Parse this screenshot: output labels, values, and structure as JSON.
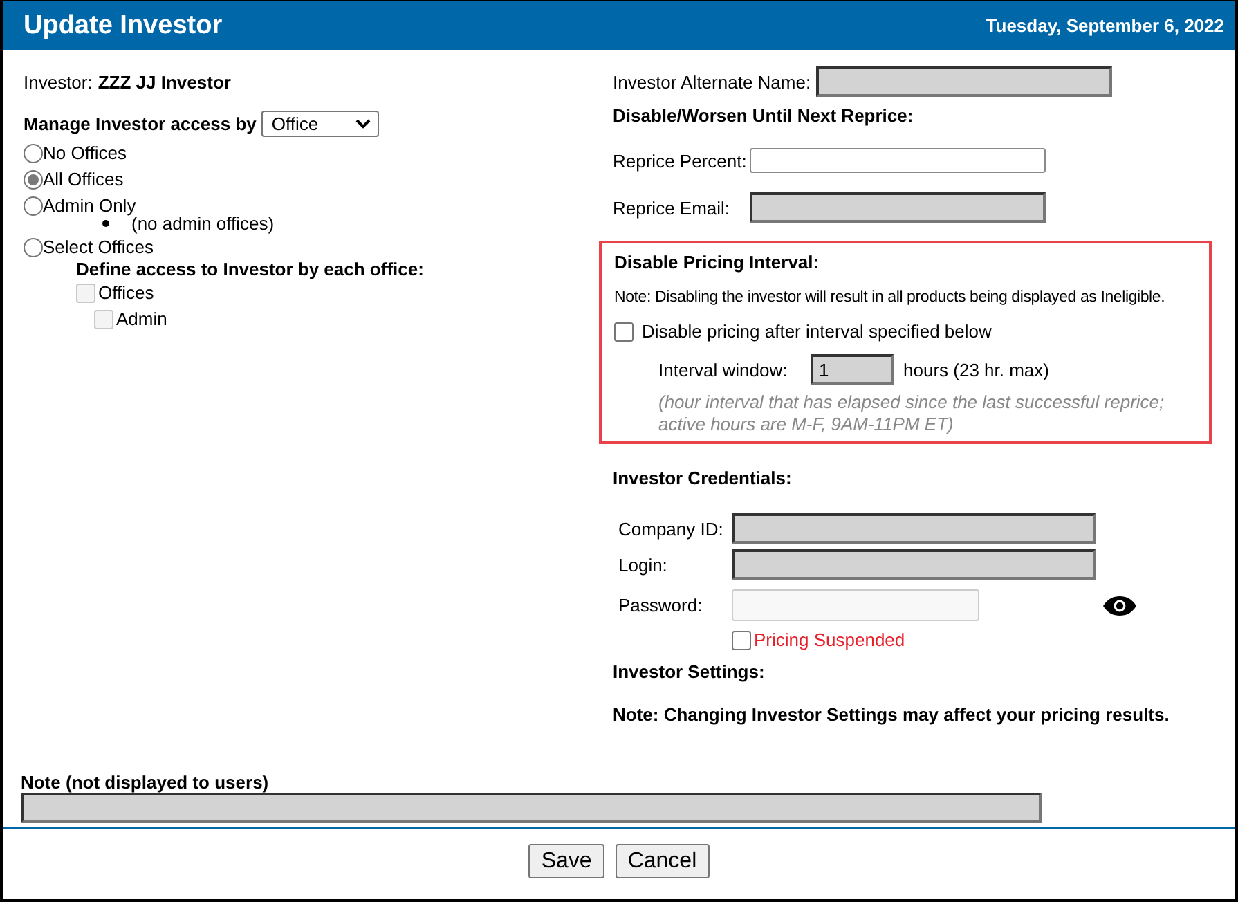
{
  "window": {
    "title": "Update Investor",
    "date": "Tuesday, September 6, 2022"
  },
  "investor": {
    "label": "Investor:",
    "name": "ZZZ JJ Investor"
  },
  "access": {
    "label": "Manage Investor access by",
    "select_value": "Office",
    "options": [
      {
        "label": "No Offices",
        "selected": false
      },
      {
        "label": "All Offices",
        "selected": true
      },
      {
        "label": "Admin Only",
        "selected": false,
        "notes": [
          "(no admin offices)"
        ]
      },
      {
        "label": "Select Offices",
        "selected": false
      }
    ],
    "define_label": "Define access to Investor by each office:",
    "offices": [
      {
        "label": "Offices",
        "checked": false,
        "disabled": true,
        "children": [
          {
            "label": "Admin",
            "checked": false,
            "disabled": true
          }
        ]
      }
    ]
  },
  "alternate_name": {
    "label": "Investor Alternate Name:",
    "disabled": true
  },
  "reprice": {
    "heading": "Disable/Worsen Until Next Reprice:",
    "fields": [
      {
        "label": "Reprice Percent:",
        "kind": "text",
        "disabled": false
      },
      {
        "label": "Reprice Email:",
        "kind": "text",
        "disabled": true
      }
    ]
  },
  "pricing_interval": {
    "heading": "Disable Pricing Interval:",
    "note": "Note: Disabling the investor will result in all products being displayed as Ineligible.",
    "checkbox": {
      "label": "Disable pricing after interval specified below",
      "checked": false
    },
    "interval": {
      "label": "Interval window:",
      "value": "1",
      "disabled": true,
      "suffix": "hours (23 hr. max)"
    },
    "hint": "(hour interval that has elapsed since the last successful reprice; active hours are M-F, 9AM-11PM ET)"
  },
  "credentials": {
    "heading": "Investor Credentials:",
    "fields": [
      {
        "label": "Company ID:",
        "kind": "text",
        "disabled": true
      },
      {
        "label": "Login:",
        "kind": "text",
        "disabled": true
      },
      {
        "label": "Password:",
        "kind": "password",
        "disabled": false
      }
    ],
    "suspended": {
      "label": "Pricing Suspended",
      "checked": false
    }
  },
  "settings": {
    "heading": "Investor Settings:",
    "note": "Note: Changing Investor Settings may affect your pricing results."
  },
  "note_field": {
    "label": "Note (not displayed to users)",
    "disabled": true
  },
  "buttons": [
    {
      "label": "Save"
    },
    {
      "label": "Cancel"
    }
  ]
}
